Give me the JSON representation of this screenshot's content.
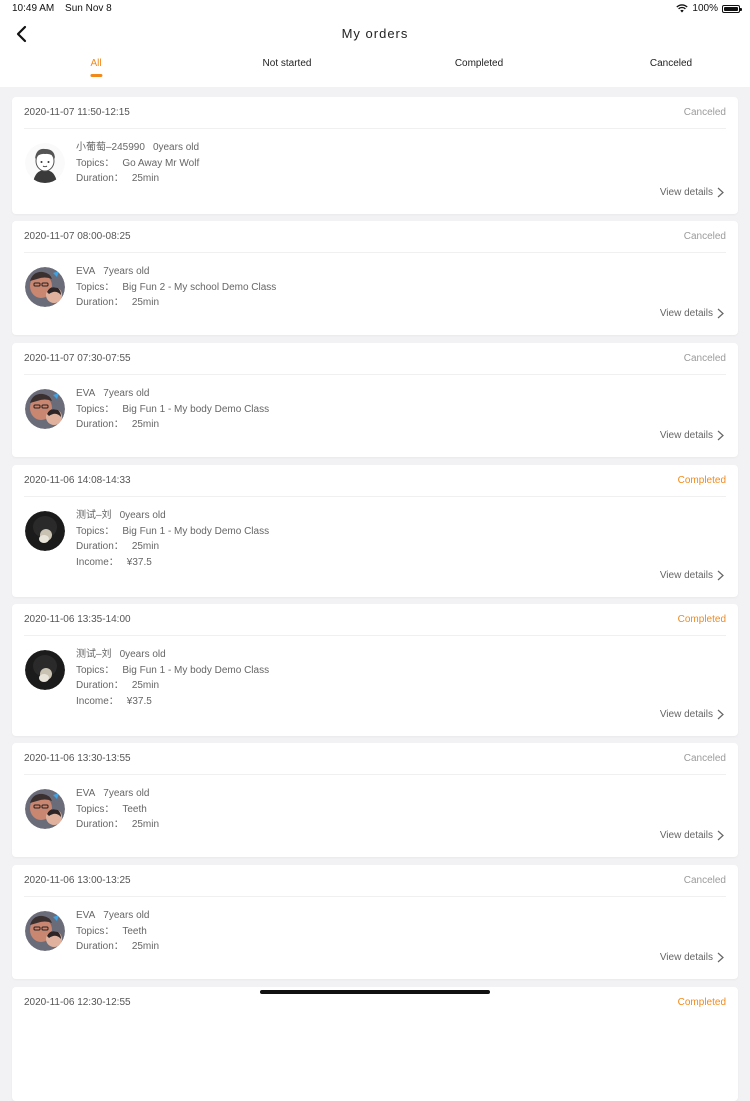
{
  "status_bar": {
    "time": "10:49 AM",
    "date": "Sun Nov 8",
    "battery": "100%"
  },
  "header": {
    "title": "My orders"
  },
  "tabs": [
    {
      "label": "All",
      "active": true
    },
    {
      "label": "Not started",
      "active": false
    },
    {
      "label": "Completed",
      "active": false
    },
    {
      "label": "Canceled",
      "active": false
    }
  ],
  "colors": {
    "accent": "#f08a1d",
    "canceled": "#9b9b9b",
    "background": "#f2f2f4"
  },
  "view_details_label": "View details",
  "orders": [
    {
      "time_range": "2020-11-07 11:50-12:15",
      "status": "Canceled",
      "name": "小葡萄–245990",
      "age": "0years old",
      "topics_label": "Topics：",
      "topic": "Go Away Mr Wolf",
      "duration_label": "Duration：",
      "duration": "25min",
      "avatar": "cartoon-boy-avatar"
    },
    {
      "time_range": "2020-11-07 08:00-08:25",
      "status": "Canceled",
      "name": "EVA",
      "age": "7years old",
      "topics_label": "Topics：",
      "topic": "Big Fun 2 - My school Demo Class",
      "duration_label": "Duration：",
      "duration": "25min",
      "avatar": "family-photo-avatar"
    },
    {
      "time_range": "2020-11-07 07:30-07:55",
      "status": "Canceled",
      "name": "EVA",
      "age": "7years old",
      "topics_label": "Topics：",
      "topic": "Big Fun 1 - My body Demo Class",
      "duration_label": "Duration：",
      "duration": "25min",
      "avatar": "family-photo-avatar"
    },
    {
      "time_range": "2020-11-06 14:08-14:33",
      "status": "Completed",
      "name": "测试–刘",
      "age": "0years old",
      "topics_label": "Topics：",
      "topic": "Big Fun 1 - My body Demo Class",
      "duration_label": "Duration：",
      "duration": "25min",
      "income_label": "Income：",
      "income": "¥37.5",
      "avatar": "dark-photo-avatar"
    },
    {
      "time_range": "2020-11-06 13:35-14:00",
      "status": "Completed",
      "name": "测试–刘",
      "age": "0years old",
      "topics_label": "Topics：",
      "topic": "Big Fun 1 - My body Demo Class",
      "duration_label": "Duration：",
      "duration": "25min",
      "income_label": "Income：",
      "income": "¥37.5",
      "avatar": "dark-photo-avatar"
    },
    {
      "time_range": "2020-11-06 13:30-13:55",
      "status": "Canceled",
      "name": "EVA",
      "age": "7years old",
      "topics_label": "Topics：",
      "topic": "Teeth",
      "duration_label": "Duration：",
      "duration": "25min",
      "avatar": "family-photo-avatar"
    },
    {
      "time_range": "2020-11-06 13:00-13:25",
      "status": "Canceled",
      "name": "EVA",
      "age": "7years old",
      "topics_label": "Topics：",
      "topic": "Teeth",
      "duration_label": "Duration：",
      "duration": "25min",
      "avatar": "family-photo-avatar"
    },
    {
      "time_range": "2020-11-06 12:30-12:55",
      "status": "Completed",
      "avatar": "dark-photo-avatar"
    }
  ]
}
